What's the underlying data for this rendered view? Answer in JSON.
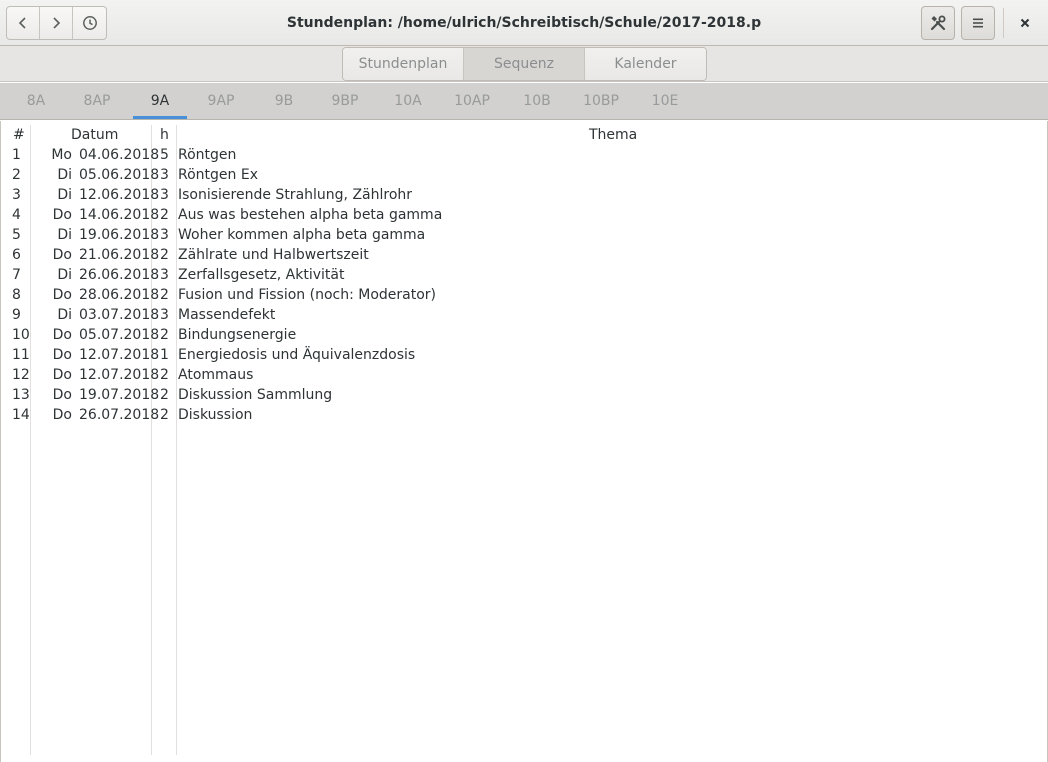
{
  "window": {
    "title": "Stundenplan: /home/ulrich/Schreibtisch/Schule/2017-2018.p"
  },
  "switcher": {
    "items": [
      "Stundenplan",
      "Sequenz",
      "Kalender"
    ],
    "active": "Sequenz"
  },
  "tabs": {
    "items": [
      "8A",
      "8AP",
      "9A",
      "9AP",
      "9B",
      "9BP",
      "10A",
      "10AP",
      "10B",
      "10BP",
      "10E"
    ],
    "active": "9A"
  },
  "table": {
    "headers": {
      "num": "#",
      "datum": "Datum",
      "h": "h",
      "thema": "Thema"
    },
    "rows": [
      {
        "num": "1",
        "weekday": "Mo",
        "date": "04.06.2018",
        "h": "5",
        "thema": "Röntgen"
      },
      {
        "num": "2",
        "weekday": "Di",
        "date": "05.06.2018",
        "h": "3",
        "thema": "Röntgen Ex"
      },
      {
        "num": "3",
        "weekday": "Di",
        "date": "12.06.2018",
        "h": "3",
        "thema": "Isonisierende Strahlung, Zählrohr"
      },
      {
        "num": "4",
        "weekday": "Do",
        "date": "14.06.2018",
        "h": "2",
        "thema": "Aus was bestehen alpha beta gamma"
      },
      {
        "num": "5",
        "weekday": "Di",
        "date": "19.06.2018",
        "h": "3",
        "thema": "Woher kommen alpha beta gamma"
      },
      {
        "num": "6",
        "weekday": "Do",
        "date": "21.06.2018",
        "h": "2",
        "thema": "Zählrate und Halbwertszeit"
      },
      {
        "num": "7",
        "weekday": "Di",
        "date": "26.06.2018",
        "h": "3",
        "thema": "Zerfallsgesetz, Aktivität"
      },
      {
        "num": "8",
        "weekday": "Do",
        "date": "28.06.2018",
        "h": "2",
        "thema": "Fusion und Fission (noch: Moderator)"
      },
      {
        "num": "9",
        "weekday": "Di",
        "date": "03.07.2018",
        "h": "3",
        "thema": "Massendefekt"
      },
      {
        "num": "10",
        "weekday": "Do",
        "date": "05.07.2018",
        "h": "2",
        "thema": "Bindungsenergie"
      },
      {
        "num": "11",
        "weekday": "Do",
        "date": "12.07.2018",
        "h": "1",
        "thema": "Energiedosis und Äquivalenzdosis"
      },
      {
        "num": "12",
        "weekday": "Do",
        "date": "12.07.2018",
        "h": "2",
        "thema": "Atommaus"
      },
      {
        "num": "13",
        "weekday": "Do",
        "date": "19.07.2018",
        "h": "2",
        "thema": "Diskussion Sammlung"
      },
      {
        "num": "14",
        "weekday": "Do",
        "date": "26.07.2018",
        "h": "2",
        "thema": "Diskussion"
      }
    ]
  },
  "icons": {
    "back": "chevron-left-icon",
    "forward": "chevron-right-icon",
    "history": "clock-icon",
    "tools": "tools-icon",
    "menu": "hamburger-menu-icon",
    "close": "close-icon"
  },
  "colors": {
    "accent": "#4a90d9"
  }
}
